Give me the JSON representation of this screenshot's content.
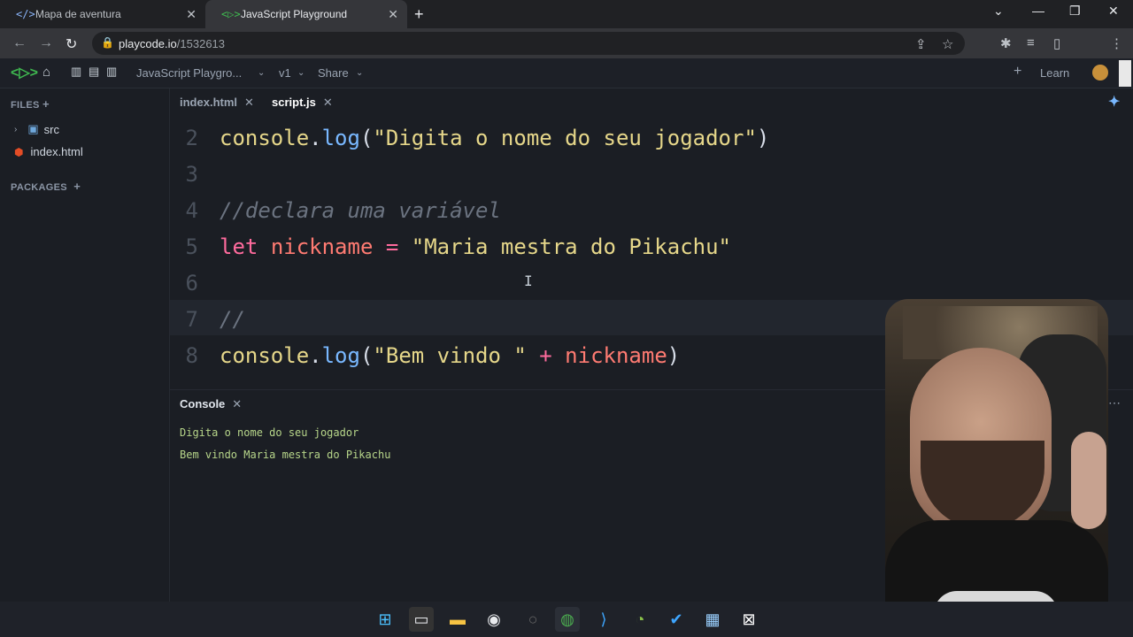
{
  "browser": {
    "tabs": [
      {
        "label": "Mapa de aventura",
        "icon": "code-icon"
      },
      {
        "label": "JavaScript Playground",
        "icon": "playcode-icon"
      }
    ],
    "url_host": "playcode.io",
    "url_path": "/1532613"
  },
  "app": {
    "project_name": "JavaScript Playgro...",
    "version": "v1",
    "share_label": "Share",
    "learn_label": "Learn"
  },
  "sidebar": {
    "files_header": "FILES",
    "items": [
      {
        "label": "src",
        "icon": "folder-icon"
      },
      {
        "label": "index.html",
        "icon": "html-icon"
      }
    ],
    "packages_header": "PACKAGES"
  },
  "editor": {
    "tabs": [
      {
        "label": "index.html"
      },
      {
        "label": "script.js"
      }
    ],
    "lines": [
      {
        "num": "2"
      },
      {
        "num": "3"
      },
      {
        "num": "4"
      },
      {
        "num": "5"
      },
      {
        "num": "6"
      },
      {
        "num": "7"
      },
      {
        "num": "8"
      }
    ],
    "tokens": {
      "l2_a": "console",
      "l2_b": ".",
      "l2_c": "log",
      "l2_d": "(",
      "l2_e": "\"Digita o nome do seu jogador\"",
      "l2_f": ")",
      "l4_a": "//declara uma variável",
      "l5_a": "let",
      "l5_b": "nickname",
      "l5_c": "=",
      "l5_d": "\"Maria mestra do Pikachu\"",
      "l7_a": "//",
      "l8_a": "console",
      "l8_b": ".",
      "l8_c": "log",
      "l8_d": "(",
      "l8_e": "\"Bem vindo \"",
      "l8_f": "+",
      "l8_g": "nickname",
      "l8_h": ")"
    }
  },
  "console": {
    "title": "Console",
    "output": [
      "Digita o nome do seu jogador",
      "Bem vindo Maria mestra do Pikachu"
    ]
  },
  "colors": {
    "accent": "#2ea043",
    "keyword": "#ff6b9d",
    "function": "#79b8ff",
    "string": "#e6d78a"
  }
}
